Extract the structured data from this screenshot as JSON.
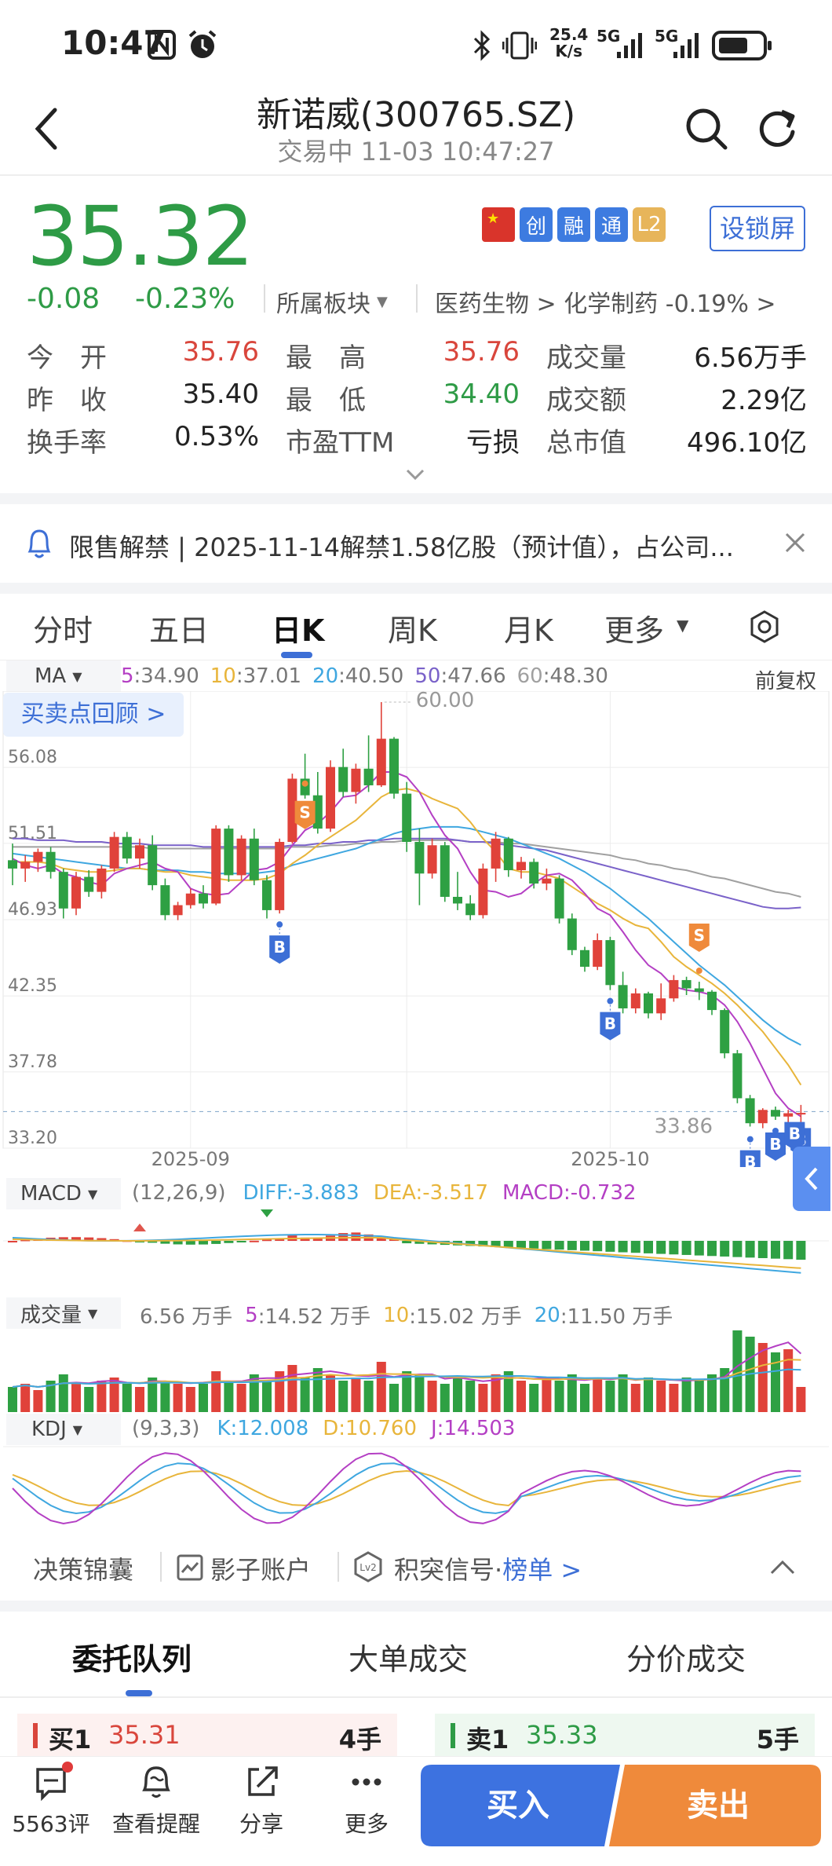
{
  "status_bar": {
    "time": "10:47",
    "network_speed": "25.4\nK/s",
    "net_left": "5G",
    "net_right": "5G"
  },
  "header": {
    "title": "新诺威(300765.SZ)",
    "subtitle": "交易中 11-03 10:47:27"
  },
  "quote": {
    "price": "35.32",
    "change": "-0.08",
    "change_pct": "-0.23%",
    "sector_label": "所属板块",
    "sector_path": "医药生物 > 化学制药 -0.19% >",
    "badges": [
      "创",
      "融",
      "通",
      "L2"
    ],
    "lock_btn": "设锁屏",
    "stats": [
      {
        "label": "今　开",
        "value": "35.76",
        "color": "red"
      },
      {
        "label": "最　高",
        "value": "35.76",
        "color": "red"
      },
      {
        "label": "成交量",
        "value": "6.56万手",
        "color": "dark"
      },
      {
        "label": "昨　收",
        "value": "35.40",
        "color": "dark"
      },
      {
        "label": "最　低",
        "value": "34.40",
        "color": "green"
      },
      {
        "label": "成交额",
        "value": "2.29亿",
        "color": "dark"
      },
      {
        "label": "换手率",
        "value": "0.53%",
        "color": "dark"
      },
      {
        "label": "市盈TTM",
        "value": "亏损",
        "color": "dark"
      },
      {
        "label": "总市值",
        "value": "496.10亿",
        "color": "dark"
      }
    ]
  },
  "notice": {
    "text": "限售解禁 | 2025-11-14解禁1.58亿股（预计值），占公司..."
  },
  "chart_tabs": [
    "分时",
    "五日",
    "日K",
    "周K",
    "月K",
    "更多"
  ],
  "chart_tabs_active": "日K",
  "ma_legend": {
    "label": "MA",
    "items": [
      {
        "k": "5",
        "v": ":34.90",
        "color": "#b43fc4"
      },
      {
        "k": "10",
        "v": ":37.01",
        "color": "#e8b53b"
      },
      {
        "k": "20",
        "v": ":40.50",
        "color": "#3fa7e0"
      },
      {
        "k": "50",
        "v": ":47.66",
        "color": "#7a62c9"
      },
      {
        "k": "60",
        "v": ":48.30",
        "color": "#a0a0a0"
      }
    ],
    "adjust": "前复权"
  },
  "review_btn": "买卖点回顾 >",
  "chart_data": {
    "type": "candlestick",
    "y_ticks": [
      "56.08",
      "51.51",
      "46.93",
      "42.35",
      "37.78",
      "33.20"
    ],
    "x_ticks": [
      "2025-09",
      "2025-10"
    ],
    "max_label": "60.00",
    "min_label": "33.86",
    "ylim": [
      33.2,
      60.66
    ],
    "candles": [
      [
        50.5,
        51.5,
        49.0,
        50.0
      ],
      [
        50.0,
        50.8,
        49.2,
        50.4
      ],
      [
        50.4,
        51.2,
        49.8,
        51.0
      ],
      [
        51.0,
        51.3,
        49.4,
        49.8
      ],
      [
        49.8,
        50.0,
        47.0,
        47.6
      ],
      [
        47.6,
        49.8,
        47.2,
        49.5
      ],
      [
        49.5,
        49.9,
        48.3,
        48.6
      ],
      [
        48.6,
        50.2,
        48.2,
        50.0
      ],
      [
        50.0,
        52.2,
        49.8,
        51.9
      ],
      [
        51.9,
        52.2,
        50.3,
        50.6
      ],
      [
        50.6,
        51.8,
        50.0,
        51.4
      ],
      [
        51.4,
        52.0,
        48.7,
        49.0
      ],
      [
        49.0,
        49.4,
        46.9,
        47.2
      ],
      [
        47.2,
        48.0,
        46.9,
        47.8
      ],
      [
        47.8,
        48.8,
        47.6,
        48.5
      ],
      [
        48.5,
        49.0,
        47.6,
        47.9
      ],
      [
        47.9,
        52.6,
        47.8,
        52.4
      ],
      [
        52.4,
        52.6,
        49.2,
        49.6
      ],
      [
        49.6,
        52.0,
        49.3,
        51.8
      ],
      [
        51.8,
        52.4,
        49.0,
        49.3
      ],
      [
        49.3,
        49.6,
        47.0,
        47.5
      ],
      [
        47.5,
        51.8,
        47.3,
        51.6
      ],
      [
        51.6,
        55.7,
        51.5,
        55.4
      ],
      [
        55.4,
        56.9,
        54.2,
        54.4
      ],
      [
        54.4,
        55.8,
        52.1,
        52.4
      ],
      [
        52.4,
        56.5,
        52.2,
        56.1
      ],
      [
        56.1,
        57.2,
        54.3,
        54.6
      ],
      [
        54.6,
        56.3,
        53.9,
        56.0
      ],
      [
        56.0,
        58.0,
        54.6,
        55.0
      ],
      [
        55.0,
        60.0,
        54.9,
        57.8
      ],
      [
        57.8,
        57.9,
        54.2,
        54.5
      ],
      [
        54.5,
        55.2,
        51.0,
        51.6
      ],
      [
        51.6,
        52.4,
        47.8,
        49.7
      ],
      [
        49.7,
        51.8,
        49.4,
        51.4
      ],
      [
        51.4,
        51.6,
        48.0,
        48.3
      ],
      [
        48.3,
        49.8,
        47.5,
        47.9
      ],
      [
        47.9,
        48.4,
        46.9,
        47.2
      ],
      [
        47.2,
        50.3,
        47.0,
        50.0
      ],
      [
        50.0,
        52.2,
        49.2,
        51.8
      ],
      [
        51.8,
        51.9,
        49.5,
        49.9
      ],
      [
        49.9,
        50.7,
        49.4,
        50.4
      ],
      [
        50.4,
        50.6,
        48.8,
        49.1
      ],
      [
        49.1,
        50.0,
        48.7,
        49.4
      ],
      [
        49.4,
        49.6,
        46.7,
        47.0
      ],
      [
        47.0,
        47.3,
        44.8,
        45.1
      ],
      [
        45.1,
        45.3,
        43.8,
        44.1
      ],
      [
        44.1,
        46.1,
        43.9,
        45.7
      ],
      [
        45.7,
        45.9,
        42.7,
        43.0
      ],
      [
        43.0,
        43.8,
        41.3,
        41.6
      ],
      [
        41.6,
        42.8,
        41.3,
        42.5
      ],
      [
        42.5,
        42.6,
        41.0,
        41.3
      ],
      [
        41.3,
        43.1,
        40.9,
        42.2
      ],
      [
        42.2,
        43.6,
        42.0,
        43.3
      ],
      [
        43.3,
        43.5,
        42.4,
        42.8
      ],
      [
        42.8,
        43.2,
        42.1,
        42.6
      ],
      [
        42.6,
        42.7,
        41.2,
        41.5
      ],
      [
        41.5,
        41.6,
        38.6,
        38.9
      ],
      [
        38.9,
        39.1,
        35.9,
        36.2
      ],
      [
        36.2,
        36.4,
        34.5,
        34.7
      ],
      [
        34.7,
        35.6,
        34.4,
        35.5
      ],
      [
        35.5,
        35.7,
        34.9,
        35.1
      ],
      [
        35.1,
        35.5,
        34.6,
        35.3
      ],
      [
        35.3,
        35.8,
        34.4,
        35.32
      ]
    ],
    "ma5": [
      50.6,
      50.2,
      50.0,
      50.2,
      49.7,
      49.5,
      49.2,
      49.0,
      49.7,
      50.0,
      50.2,
      50.4,
      50.0,
      49.8,
      48.8,
      48.5,
      48.4,
      48.5,
      49.2,
      49.9,
      50.0,
      50.4,
      51.4,
      52.3,
      52.7,
      53.4,
      54.3,
      54.4,
      55.0,
      55.8,
      55.8,
      55.5,
      54.6,
      53.2,
      52.0,
      51.2,
      49.8,
      48.7,
      48.6,
      48.3,
      48.5,
      49.1,
      49.6,
      49.7,
      49.3,
      48.5,
      47.6,
      47.2,
      46.2,
      45.1,
      44.2,
      43.7,
      42.9,
      42.7,
      42.6,
      42.4,
      41.8,
      40.8,
      39.5,
      38.0,
      36.5,
      35.6,
      35.1
    ],
    "ma10": [
      50.4,
      50.4,
      50.4,
      50.3,
      50.0,
      49.9,
      49.8,
      49.8,
      49.9,
      50.0,
      50.0,
      49.9,
      49.8,
      49.8,
      49.6,
      49.5,
      49.4,
      49.3,
      49.3,
      49.3,
      49.4,
      49.7,
      50.3,
      50.8,
      51.4,
      51.9,
      52.4,
      52.9,
      53.6,
      54.3,
      54.7,
      54.8,
      54.6,
      54.2,
      53.9,
      53.6,
      52.8,
      51.8,
      51.0,
      50.0,
      49.8,
      49.8,
      49.6,
      49.4,
      48.9,
      48.4,
      47.9,
      47.5,
      47.0,
      46.6,
      46.4,
      45.6,
      44.7,
      44.1,
      43.6,
      43.1,
      42.5,
      41.8,
      41.0,
      40.2,
      39.2,
      38.2,
      37.0
    ],
    "ma20": [
      50.9,
      50.8,
      50.7,
      50.6,
      50.5,
      50.4,
      50.3,
      50.2,
      50.1,
      50.0,
      50.0,
      49.9,
      49.9,
      49.9,
      49.8,
      49.8,
      49.7,
      49.7,
      49.7,
      49.7,
      49.8,
      49.9,
      50.2,
      50.4,
      50.6,
      50.8,
      51.0,
      51.2,
      51.5,
      51.8,
      52.1,
      52.3,
      52.4,
      52.5,
      52.5,
      52.5,
      52.4,
      52.2,
      52.0,
      51.8,
      51.5,
      51.2,
      50.9,
      50.6,
      50.2,
      49.8,
      49.3,
      48.8,
      48.2,
      47.6,
      47.0,
      46.3,
      45.6,
      44.9,
      44.2,
      43.6,
      43.0,
      42.3,
      41.6,
      40.9,
      40.3,
      39.8,
      39.4
    ],
    "ma50": [
      51.8,
      51.8,
      51.7,
      51.7,
      51.7,
      51.6,
      51.6,
      51.6,
      51.5,
      51.5,
      51.5,
      51.4,
      51.4,
      51.4,
      51.4,
      51.3,
      51.3,
      51.3,
      51.3,
      51.3,
      51.3,
      51.3,
      51.4,
      51.4,
      51.5,
      51.5,
      51.6,
      51.6,
      51.7,
      51.7,
      51.8,
      51.8,
      51.8,
      51.8,
      51.8,
      51.7,
      51.6,
      51.6,
      51.5,
      51.4,
      51.3,
      51.2,
      51.1,
      50.9,
      50.7,
      50.5,
      50.3,
      50.1,
      49.9,
      49.7,
      49.5,
      49.3,
      49.1,
      48.9,
      48.7,
      48.5,
      48.3,
      48.1,
      47.9,
      47.7,
      47.6,
      47.6,
      47.66
    ],
    "ma60": [
      51.3,
      51.3,
      51.3,
      51.3,
      51.3,
      51.3,
      51.3,
      51.3,
      51.3,
      51.3,
      51.3,
      51.2,
      51.2,
      51.2,
      51.2,
      51.2,
      51.2,
      51.2,
      51.2,
      51.2,
      51.2,
      51.2,
      51.3,
      51.3,
      51.3,
      51.4,
      51.4,
      51.5,
      51.5,
      51.6,
      51.6,
      51.7,
      51.7,
      51.7,
      51.7,
      51.7,
      51.6,
      51.6,
      51.6,
      51.5,
      51.5,
      51.4,
      51.3,
      51.2,
      51.1,
      51.0,
      50.9,
      50.8,
      50.6,
      50.5,
      50.3,
      50.2,
      50.0,
      49.9,
      49.7,
      49.5,
      49.4,
      49.2,
      49.0,
      48.8,
      48.6,
      48.5,
      48.3
    ],
    "signals": [
      {
        "type": "B",
        "i": 21
      },
      {
        "type": "S",
        "i": 23
      },
      {
        "type": "B",
        "i": 47
      },
      {
        "type": "S",
        "i": 54
      },
      {
        "type": "B",
        "i": 59
      },
      {
        "type": "B",
        "i": 60
      },
      {
        "type": "B",
        "i": 61
      },
      {
        "type": "B",
        "i": 62
      }
    ],
    "macd": {
      "label": "MACD",
      "params": "(12,26,9)",
      "diff": "DIFF:-3.883",
      "dea": "DEA:-3.517",
      "macd": "MACD:-0.732"
    },
    "volume": {
      "label": "成交量",
      "v": "6.56 万手",
      "ma5": "14.52 万手",
      "ma10": "15.02 万手",
      "ma20": "11.50 万手",
      "values": [
        8,
        9,
        7,
        10,
        12,
        9,
        8,
        10,
        11,
        9,
        8,
        11,
        10,
        9,
        8,
        9,
        13,
        10,
        9,
        12,
        10,
        13,
        15,
        11,
        14,
        12,
        10,
        11,
        10,
        16,
        9,
        13,
        12,
        10,
        9,
        11,
        10,
        9,
        12,
        13,
        10,
        9,
        11,
        10,
        12,
        9,
        11,
        10,
        12,
        9,
        11,
        10,
        9,
        11,
        10,
        12,
        14,
        26,
        24,
        22,
        19,
        20,
        8
      ]
    },
    "kdj": {
      "label": "KDJ",
      "params": "(9,3,3)",
      "k": "K:12.008",
      "d": "D:10.760",
      "j": "J:14.503"
    }
  },
  "tools_row": {
    "a": "决策锦囊",
    "b": "影子账户",
    "c": "积突信号·",
    "c_link": "榜单 >"
  },
  "order_tabs": [
    "委托队列",
    "大单成交",
    "分价成交"
  ],
  "order_book": {
    "bid": {
      "label": "买1",
      "price": "35.31",
      "qty": "4手"
    },
    "ask": {
      "label": "卖1",
      "price": "35.33",
      "qty": "5手"
    }
  },
  "bottom_bar": {
    "comments": "5563评",
    "alert": "查看提醒",
    "share": "分享",
    "more": "更多",
    "buy": "买入",
    "sell": "卖出"
  }
}
